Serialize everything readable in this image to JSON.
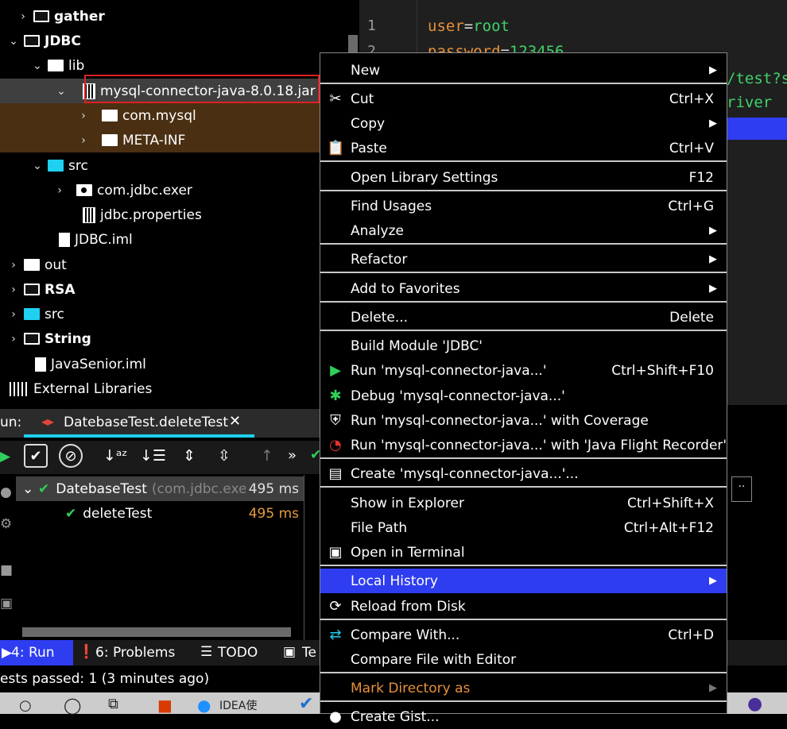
{
  "tree": {
    "items": [
      {
        "label": "gather",
        "arrow": "›"
      },
      {
        "label": "JDBC",
        "arrow": "⌄"
      },
      {
        "label": "lib",
        "arrow": "⌄"
      },
      {
        "label": "mysql-connector-java-8.0.18.jar",
        "arrow": "⌄"
      },
      {
        "label": "com.mysql",
        "arrow": "›"
      },
      {
        "label": "META-INF",
        "arrow": "›"
      },
      {
        "label": "src",
        "arrow": "⌄"
      },
      {
        "label": "com.jdbc.exer",
        "arrow": "›"
      },
      {
        "label": "jdbc.properties"
      },
      {
        "label": "JDBC.iml"
      },
      {
        "label": "out",
        "arrow": "›"
      },
      {
        "label": "RSA",
        "arrow": "›"
      },
      {
        "label": "src",
        "arrow": "›"
      },
      {
        "label": "String",
        "arrow": "›"
      },
      {
        "label": "JavaSenior.iml"
      },
      {
        "label": "External Libraries"
      }
    ]
  },
  "editor": {
    "lines": [
      "1",
      "2"
    ],
    "code": [
      {
        "key": "user",
        "val": "root"
      },
      {
        "key": "password",
        "val": "123456"
      }
    ],
    "partial": [
      "/test?s",
      "river"
    ]
  },
  "run": {
    "label": "un:",
    "tab": "DatebaseTest.deleteTest",
    "suite": "DatebaseTest",
    "suite_pkg": "(com.jdbc.exer",
    "suite_ms": "495 ms",
    "test": "deleteTest",
    "test_ms": "495 ms"
  },
  "statusbar": {
    "run": "4: Run",
    "problems": "6: Problems",
    "todo": "TODO",
    "terminal": "Te",
    "tests": "ests passed: 1 (3 minutes ago)"
  },
  "taskbar": {
    "app": "IDEA使"
  },
  "menu": {
    "new": "New",
    "cut": "Cut",
    "cut_sc": "Ctrl+X",
    "copy": "Copy",
    "paste": "Paste",
    "paste_sc": "Ctrl+V",
    "lib_settings": "Open Library Settings",
    "lib_settings_sc": "F12",
    "find_usages": "Find Usages",
    "find_usages_sc": "Ctrl+G",
    "analyze": "Analyze",
    "refactor": "Refactor",
    "favorites": "Add to Favorites",
    "delete": "Delete...",
    "delete_sc": "Delete",
    "build": "Build Module 'JDBC'",
    "run": "Run 'mysql-connector-java...'",
    "run_sc": "Ctrl+Shift+F10",
    "debug": "Debug 'mysql-connector-java...'",
    "coverage": "Run 'mysql-connector-java...' with Coverage",
    "jfr": "Run 'mysql-connector-java...' with 'Java Flight Recorder'",
    "create": "Create 'mysql-connector-java...'...",
    "explorer": "Show in Explorer",
    "explorer_sc": "Ctrl+Shift+X",
    "file_path": "File Path",
    "file_path_sc": "Ctrl+Alt+F12",
    "terminal": "Open in Terminal",
    "local_history": "Local History",
    "reload": "Reload from Disk",
    "compare": "Compare With...",
    "compare_sc": "Ctrl+D",
    "compare_editor": "Compare File with Editor",
    "mark_dir": "Mark Directory as",
    "create_gist": "Create Gist..."
  },
  "colors": {
    "highlight": "#2f3df0",
    "key": "#e8913a",
    "value": "#3fd26a",
    "check": "#2fd05a"
  }
}
